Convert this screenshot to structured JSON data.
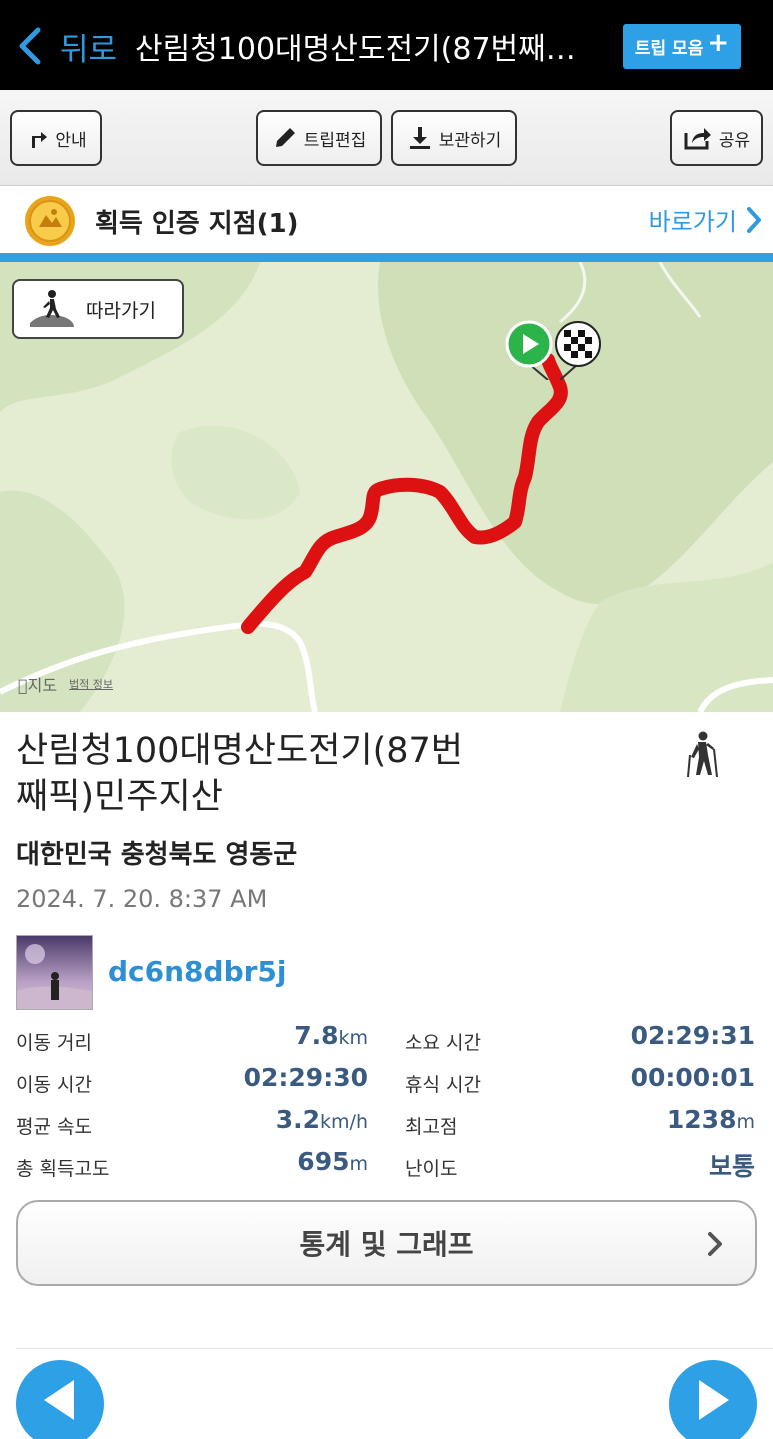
{
  "nav": {
    "back_label": "뒤로",
    "title": "산림청100대명산도전기(87번째…",
    "trip_collection_label": "트립 모음"
  },
  "toolbar": {
    "guide_label": "안내",
    "edit_label": "트립편집",
    "save_label": "보관하기",
    "share_label": "공유"
  },
  "badge": {
    "label": "획득 인증 지점(1)",
    "shortcut_label": "바로가기"
  },
  "map": {
    "follow_label": "따라가기",
    "attribution": "지도",
    "legal": "법적 정보",
    "route_color": "#dd1111"
  },
  "trip": {
    "title": "산림청100대명산도전기(87번째픽)민주지산",
    "location": "대한민국 충청북도 영동군",
    "datetime": "2024. 7. 20. 8:37 AM",
    "username": "dc6n8dbr5j",
    "activity_icon": "hiker-icon"
  },
  "stats": {
    "distance": {
      "label": "이동 거리",
      "value": "7.8",
      "unit": "km"
    },
    "elapsed": {
      "label": "소요 시간",
      "value": "02:29:31",
      "unit": ""
    },
    "moving_time": {
      "label": "이동 시간",
      "value": "02:29:30",
      "unit": ""
    },
    "rest_time": {
      "label": "휴식 시간",
      "value": "00:00:01",
      "unit": ""
    },
    "avg_speed": {
      "label": "평균 속도",
      "value": "3.2",
      "unit": "km/h"
    },
    "max_altitude": {
      "label": "최고점",
      "value": "1238",
      "unit": "m"
    },
    "total_ascent": {
      "label": "총 획득고도",
      "value": "695",
      "unit": "m"
    },
    "difficulty": {
      "label": "난이도",
      "value": "보통",
      "unit": ""
    }
  },
  "graph_button_label": "통계 및 그래프",
  "colors": {
    "accent": "#2ea0e6",
    "link": "#2f8fd3",
    "stat_value": "#3b5a80"
  }
}
